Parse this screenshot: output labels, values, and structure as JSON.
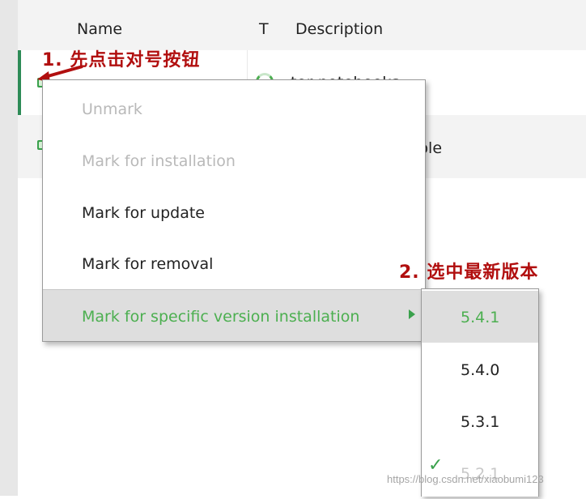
{
  "table": {
    "headers": {
      "name": "Name",
      "t": "T",
      "description": "Description"
    },
    "rows": [
      {
        "description": "Supporting jupyter notebooks",
        "visible_description": "ter notebooks"
      },
      {
        "visible_description": "ple"
      }
    ]
  },
  "annotations": {
    "step1": "1. 先点击对号按钮",
    "step2": "2. 选中最新版本"
  },
  "context_menu": {
    "items": [
      {
        "label": "Unmark",
        "state": "disabled"
      },
      {
        "label": "Mark for installation",
        "state": "disabled"
      },
      {
        "label": "Mark for update",
        "state": "enabled"
      },
      {
        "label": "Mark for removal",
        "state": "enabled"
      },
      {
        "label": "Mark for specific version installation",
        "state": "highlighted",
        "has_submenu": true
      }
    ]
  },
  "version_submenu": {
    "items": [
      {
        "label": "5.4.1",
        "state": "highlighted"
      },
      {
        "label": "5.4.0",
        "state": "normal"
      },
      {
        "label": "5.3.1",
        "state": "normal"
      },
      {
        "label": "5.2.1",
        "state": "installed",
        "icon": "check-icon"
      }
    ]
  },
  "watermark": "https://blog.csdn.net/xiaobumi123",
  "colors": {
    "accent_green": "#4caf50",
    "annotation_red": "#b10f0f",
    "checkbox_green": "#3aa14c"
  }
}
